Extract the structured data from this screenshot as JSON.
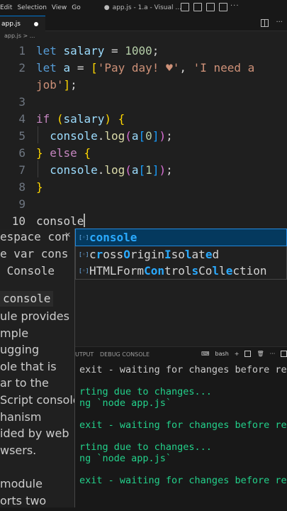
{
  "titlebar": {
    "menus": [
      "Edit",
      "Selection",
      "View",
      "Go"
    ],
    "more": "···",
    "dot": "●",
    "title": "app.js - 1.a - Visual ..."
  },
  "tab": {
    "label": "app.js"
  },
  "breadcrumb": "app.js > ...",
  "editor": {
    "line_numbers": [
      "1",
      "2",
      "3",
      "4",
      "5",
      "6",
      "7",
      "8",
      "9",
      "10"
    ],
    "lines": [
      [
        [
          "kw2",
          "let"
        ],
        [
          "plain",
          " "
        ],
        [
          "var",
          "salary"
        ],
        [
          "plain",
          " = "
        ],
        [
          "num",
          "1000"
        ],
        [
          "plain",
          ";"
        ]
      ],
      [
        [
          "kw2",
          "let"
        ],
        [
          "plain",
          " "
        ],
        [
          "var",
          "a"
        ],
        [
          "plain",
          " = "
        ],
        [
          "br1",
          "["
        ],
        [
          "str",
          "'Pay day! ♥'"
        ],
        [
          "plain",
          ", "
        ],
        [
          "str",
          "'I need a"
        ]
      ],
      [
        [
          "str",
          "job'"
        ],
        [
          "br1",
          "]"
        ],
        [
          "plain",
          ";"
        ]
      ],
      [],
      [
        [
          "kw",
          "if"
        ],
        [
          "plain",
          " "
        ],
        [
          "br1",
          "("
        ],
        [
          "var",
          "salary"
        ],
        [
          "br1",
          ")"
        ],
        [
          "plain",
          " "
        ],
        [
          "br1",
          "{"
        ]
      ],
      [
        [
          "plain",
          "  "
        ],
        [
          "var",
          "console"
        ],
        [
          "plain",
          "."
        ],
        [
          "fn",
          "log"
        ],
        [
          "br2",
          "("
        ],
        [
          "var",
          "a"
        ],
        [
          "br3",
          "["
        ],
        [
          "num",
          "0"
        ],
        [
          "br3",
          "]"
        ],
        [
          "br2",
          ")"
        ],
        [
          "plain",
          ";"
        ]
      ],
      [
        [
          "br1",
          "}"
        ],
        [
          "plain",
          " "
        ],
        [
          "kw",
          "else"
        ],
        [
          "plain",
          " "
        ],
        [
          "br1",
          "{"
        ]
      ],
      [
        [
          "plain",
          "  "
        ],
        [
          "var",
          "console"
        ],
        [
          "plain",
          "."
        ],
        [
          "fn",
          "log"
        ],
        [
          "br2",
          "("
        ],
        [
          "var",
          "a"
        ],
        [
          "br3",
          "["
        ],
        [
          "num",
          "1"
        ],
        [
          "br3",
          "]"
        ],
        [
          "br2",
          ")"
        ],
        [
          "plain",
          ";"
        ]
      ],
      [
        [
          "br1",
          "}"
        ]
      ],
      [],
      [
        [
          "plain",
          "console"
        ]
      ]
    ]
  },
  "suggest": {
    "icon": "[◦]",
    "items": [
      [
        [
          "hl",
          "console"
        ]
      ],
      [
        [
          "",
          "c"
        ],
        [
          "hl",
          "r"
        ],
        [
          "",
          "oss"
        ],
        [
          "hl",
          "O"
        ],
        [
          "",
          "rigin"
        ],
        [
          "hl",
          "I"
        ],
        [
          "",
          "so"
        ],
        [
          "hl",
          "l"
        ],
        [
          "",
          "at"
        ],
        [
          "hl",
          "e"
        ],
        [
          "",
          "d"
        ]
      ],
      [
        [
          "",
          "HTMLForm"
        ],
        [
          "hl",
          "Con"
        ],
        [
          "",
          "trol"
        ],
        [
          "hl",
          "s"
        ],
        [
          "",
          "Co"
        ],
        [
          "hl",
          "l"
        ],
        [
          "",
          "l"
        ],
        [
          "hl",
          "e"
        ],
        [
          "",
          "ction"
        ]
      ]
    ]
  },
  "details": {
    "sig1": "espace con",
    "sig2": "e var cons",
    "sig3": " Console",
    "close": "×",
    "name": "console",
    "doc": "ule provides\nmple\nugging\nole that is\nar to the\nScript console\nhanism\nided by web\nwsers.\n\nmodule\norts two"
  },
  "panel": {
    "tabs": [
      "UTPUT",
      "DEBUG CONSOLE"
    ],
    "shell": "bash",
    "plus": "+",
    "terminal": [
      [
        "",
        "exit - waiting for changes before rest"
      ],
      [
        "",
        ""
      ],
      [
        "green",
        "rting due to changes..."
      ],
      [
        "green",
        "ng `node app.js`"
      ],
      [
        "",
        ""
      ],
      [
        "green",
        "exit - waiting for changes before rest"
      ],
      [
        "",
        ""
      ],
      [
        "green",
        "rting due to changes..."
      ],
      [
        "green",
        "ng `node app.js`"
      ],
      [
        "",
        ""
      ],
      [
        "green",
        "exit - waiting for changes before rest"
      ]
    ]
  }
}
